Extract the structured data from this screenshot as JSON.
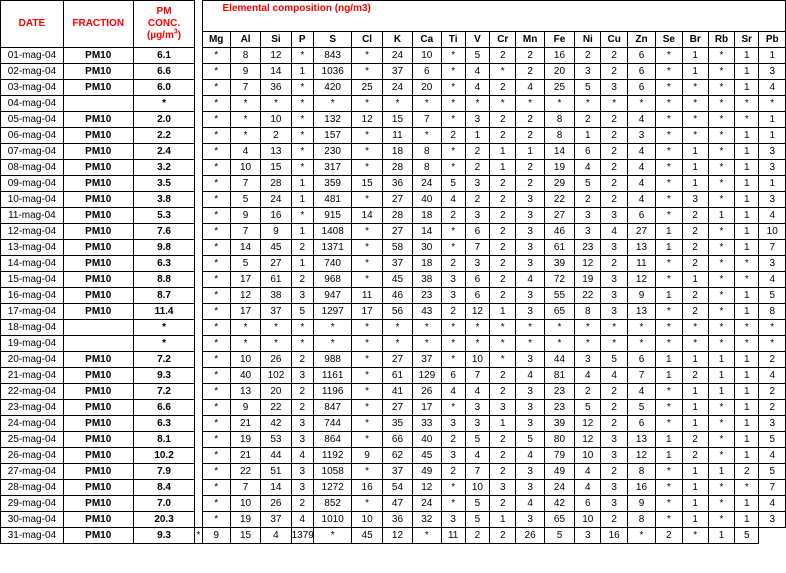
{
  "header": {
    "date_label": "DATE",
    "fraction_label": "FRACTION",
    "pm_label_1": "PM",
    "pm_label_2": "CONC.",
    "pm_unit": "(µg/m",
    "pm_unit_sup": "3",
    "pm_unit_close": ")",
    "elemental_title": "Elemental composition (ng/m3)"
  },
  "elements": [
    "Mg",
    "Al",
    "Si",
    "P",
    "S",
    "Cl",
    "K",
    "Ca",
    "Ti",
    "V",
    "Cr",
    "Mn",
    "Fe",
    "Ni",
    "Cu",
    "Zn",
    "Se",
    "Br",
    "Rb",
    "Sr",
    "Pb"
  ],
  "rows": [
    {
      "date": "01-mag-04",
      "fraction": "PM10",
      "pm": "6.1",
      "values": [
        "*",
        "8",
        "12",
        "*",
        "843",
        "*",
        "24",
        "10",
        "*",
        "5",
        "2",
        "2",
        "16",
        "2",
        "2",
        "6",
        "*",
        "1",
        "*",
        "1",
        "1"
      ]
    },
    {
      "date": "02-mag-04",
      "fraction": "PM10",
      "pm": "6.6",
      "values": [
        "*",
        "9",
        "14",
        "1",
        "1036",
        "*",
        "37",
        "6",
        "*",
        "4",
        "*",
        "2",
        "20",
        "3",
        "2",
        "6",
        "*",
        "1",
        "*",
        "1",
        "3"
      ]
    },
    {
      "date": "03-mag-04",
      "fraction": "PM10",
      "pm": "6.0",
      "values": [
        "*",
        "7",
        "36",
        "*",
        "420",
        "25",
        "24",
        "20",
        "*",
        "4",
        "2",
        "4",
        "25",
        "5",
        "3",
        "6",
        "*",
        "*",
        "*",
        "1",
        "4"
      ]
    },
    {
      "date": "04-mag-04",
      "fraction": "",
      "pm": "*",
      "values": [
        "*",
        "*",
        "*",
        "*",
        "*",
        "*",
        "*",
        "*",
        "*",
        "*",
        "*",
        "*",
        "*",
        "*",
        "*",
        "*",
        "*",
        "*",
        "*",
        "*",
        "*"
      ]
    },
    {
      "date": "05-mag-04",
      "fraction": "PM10",
      "pm": "2.0",
      "values": [
        "*",
        "*",
        "10",
        "*",
        "132",
        "12",
        "15",
        "7",
        "*",
        "3",
        "2",
        "2",
        "8",
        "2",
        "2",
        "4",
        "*",
        "*",
        "*",
        "*",
        "1"
      ]
    },
    {
      "date": "06-mag-04",
      "fraction": "PM10",
      "pm": "2.2",
      "values": [
        "*",
        "*",
        "2",
        "*",
        "157",
        "*",
        "11",
        "*",
        "2",
        "1",
        "2",
        "2",
        "8",
        "1",
        "2",
        "3",
        "*",
        "*",
        "*",
        "1",
        "1"
      ]
    },
    {
      "date": "07-mag-04",
      "fraction": "PM10",
      "pm": "2.4",
      "values": [
        "*",
        "4",
        "13",
        "*",
        "230",
        "*",
        "18",
        "8",
        "*",
        "2",
        "1",
        "1",
        "14",
        "6",
        "2",
        "4",
        "*",
        "1",
        "*",
        "1",
        "3"
      ]
    },
    {
      "date": "08-mag-04",
      "fraction": "PM10",
      "pm": "3.2",
      "values": [
        "*",
        "10",
        "15",
        "*",
        "317",
        "*",
        "28",
        "8",
        "*",
        "2",
        "1",
        "2",
        "19",
        "4",
        "2",
        "4",
        "*",
        "1",
        "*",
        "1",
        "3"
      ]
    },
    {
      "date": "09-mag-04",
      "fraction": "PM10",
      "pm": "3.5",
      "values": [
        "*",
        "7",
        "28",
        "1",
        "359",
        "15",
        "36",
        "24",
        "5",
        "3",
        "2",
        "2",
        "29",
        "5",
        "2",
        "4",
        "*",
        "1",
        "*",
        "1",
        "1"
      ]
    },
    {
      "date": "10-mag-04",
      "fraction": "PM10",
      "pm": "3.8",
      "values": [
        "*",
        "5",
        "24",
        "1",
        "481",
        "*",
        "27",
        "40",
        "4",
        "2",
        "2",
        "3",
        "22",
        "2",
        "2",
        "4",
        "*",
        "3",
        "*",
        "1",
        "3"
      ]
    },
    {
      "date": "11-mag-04",
      "fraction": "PM10",
      "pm": "5.3",
      "values": [
        "*",
        "9",
        "16",
        "*",
        "915",
        "14",
        "28",
        "18",
        "2",
        "3",
        "2",
        "3",
        "27",
        "3",
        "3",
        "6",
        "*",
        "2",
        "1",
        "1",
        "4"
      ]
    },
    {
      "date": "12-mag-04",
      "fraction": "PM10",
      "pm": "7.6",
      "values": [
        "*",
        "7",
        "9",
        "1",
        "1408",
        "*",
        "27",
        "14",
        "*",
        "6",
        "2",
        "3",
        "46",
        "3",
        "4",
        "27",
        "1",
        "2",
        "*",
        "1",
        "10"
      ]
    },
    {
      "date": "13-mag-04",
      "fraction": "PM10",
      "pm": "9.8",
      "values": [
        "*",
        "14",
        "45",
        "2",
        "1371",
        "*",
        "58",
        "30",
        "*",
        "7",
        "2",
        "3",
        "61",
        "23",
        "3",
        "13",
        "1",
        "2",
        "*",
        "1",
        "7"
      ]
    },
    {
      "date": "14-mag-04",
      "fraction": "PM10",
      "pm": "6.3",
      "values": [
        "*",
        "5",
        "27",
        "1",
        "740",
        "*",
        "37",
        "18",
        "2",
        "3",
        "2",
        "3",
        "39",
        "12",
        "2",
        "11",
        "*",
        "2",
        "*",
        "*",
        "3"
      ]
    },
    {
      "date": "15-mag-04",
      "fraction": "PM10",
      "pm": "8.8",
      "values": [
        "*",
        "17",
        "61",
        "2",
        "968",
        "*",
        "45",
        "38",
        "3",
        "6",
        "2",
        "4",
        "72",
        "19",
        "3",
        "12",
        "*",
        "1",
        "*",
        "*",
        "4"
      ]
    },
    {
      "date": "16-mag-04",
      "fraction": "PM10",
      "pm": "8.7",
      "values": [
        "*",
        "12",
        "38",
        "3",
        "947",
        "11",
        "46",
        "23",
        "3",
        "6",
        "2",
        "3",
        "55",
        "22",
        "3",
        "9",
        "1",
        "2",
        "*",
        "1",
        "5"
      ]
    },
    {
      "date": "17-mag-04",
      "fraction": "PM10",
      "pm": "11.4",
      "values": [
        "*",
        "17",
        "37",
        "5",
        "1297",
        "17",
        "56",
        "43",
        "2",
        "12",
        "1",
        "3",
        "65",
        "8",
        "3",
        "13",
        "*",
        "2",
        "*",
        "1",
        "8"
      ]
    },
    {
      "date": "18-mag-04",
      "fraction": "",
      "pm": "*",
      "values": [
        "*",
        "*",
        "*",
        "*",
        "*",
        "*",
        "*",
        "*",
        "*",
        "*",
        "*",
        "*",
        "*",
        "*",
        "*",
        "*",
        "*",
        "*",
        "*",
        "*",
        "*"
      ]
    },
    {
      "date": "19-mag-04",
      "fraction": "",
      "pm": "*",
      "values": [
        "*",
        "*",
        "*",
        "*",
        "*",
        "*",
        "*",
        "*",
        "*",
        "*",
        "*",
        "*",
        "*",
        "*",
        "*",
        "*",
        "*",
        "*",
        "*",
        "*",
        "*"
      ]
    },
    {
      "date": "20-mag-04",
      "fraction": "PM10",
      "pm": "7.2",
      "values": [
        "*",
        "10",
        "26",
        "2",
        "988",
        "*",
        "27",
        "37",
        "*",
        "10",
        "*",
        "3",
        "44",
        "3",
        "5",
        "6",
        "1",
        "1",
        "1",
        "1",
        "2"
      ]
    },
    {
      "date": "21-mag-04",
      "fraction": "PM10",
      "pm": "9.3",
      "values": [
        "*",
        "40",
        "102",
        "3",
        "1161",
        "*",
        "61",
        "129",
        "6",
        "7",
        "2",
        "4",
        "81",
        "4",
        "4",
        "7",
        "1",
        "2",
        "1",
        "1",
        "4"
      ]
    },
    {
      "date": "22-mag-04",
      "fraction": "PM10",
      "pm": "7.2",
      "values": [
        "*",
        "13",
        "20",
        "2",
        "1196",
        "*",
        "41",
        "26",
        "4",
        "4",
        "2",
        "3",
        "23",
        "2",
        "2",
        "4",
        "*",
        "1",
        "1",
        "1",
        "2"
      ]
    },
    {
      "date": "23-mag-04",
      "fraction": "PM10",
      "pm": "6.6",
      "values": [
        "*",
        "9",
        "22",
        "2",
        "847",
        "*",
        "27",
        "17",
        "*",
        "3",
        "3",
        "3",
        "23",
        "5",
        "2",
        "5",
        "*",
        "1",
        "*",
        "1",
        "2"
      ]
    },
    {
      "date": "24-mag-04",
      "fraction": "PM10",
      "pm": "6.3",
      "values": [
        "*",
        "21",
        "42",
        "3",
        "744",
        "*",
        "35",
        "33",
        "3",
        "3",
        "1",
        "3",
        "39",
        "12",
        "2",
        "6",
        "*",
        "1",
        "*",
        "1",
        "3"
      ]
    },
    {
      "date": "25-mag-04",
      "fraction": "PM10",
      "pm": "8.1",
      "values": [
        "*",
        "19",
        "53",
        "3",
        "864",
        "*",
        "66",
        "40",
        "2",
        "5",
        "2",
        "5",
        "80",
        "12",
        "3",
        "13",
        "1",
        "2",
        "*",
        "1",
        "5"
      ]
    },
    {
      "date": "26-mag-04",
      "fraction": "PM10",
      "pm": "10.2",
      "values": [
        "*",
        "21",
        "44",
        "4",
        "1192",
        "9",
        "62",
        "45",
        "3",
        "4",
        "2",
        "4",
        "79",
        "10",
        "3",
        "12",
        "1",
        "2",
        "*",
        "1",
        "4"
      ]
    },
    {
      "date": "27-mag-04",
      "fraction": "PM10",
      "pm": "7.9",
      "values": [
        "*",
        "22",
        "51",
        "3",
        "1058",
        "*",
        "37",
        "49",
        "2",
        "7",
        "2",
        "3",
        "49",
        "4",
        "2",
        "8",
        "*",
        "1",
        "1",
        "2",
        "5"
      ]
    },
    {
      "date": "28-mag-04",
      "fraction": "PM10",
      "pm": "8.4",
      "values": [
        "*",
        "7",
        "14",
        "3",
        "1272",
        "16",
        "54",
        "12",
        "*",
        "10",
        "3",
        "3",
        "24",
        "4",
        "3",
        "16",
        "*",
        "1",
        "*",
        "*",
        "7"
      ]
    },
    {
      "date": "29-mag-04",
      "fraction": "PM10",
      "pm": "7.0",
      "values": [
        "*",
        "10",
        "26",
        "2",
        "852",
        "*",
        "47",
        "24",
        "*",
        "5",
        "2",
        "4",
        "42",
        "6",
        "3",
        "9",
        "*",
        "1",
        "*",
        "1",
        "4"
      ]
    },
    {
      "date": "30-mag-04",
      "fraction": "PM10",
      "pm": "20.3",
      "values": [
        "*",
        "19",
        "37",
        "4",
        "1010",
        "10",
        "36",
        "32",
        "3",
        "5",
        "1",
        "3",
        "65",
        "10",
        "2",
        "8",
        "*",
        "1",
        "*",
        "1",
        "3"
      ]
    },
    {
      "date": "31-mag-04",
      "fraction": "PM10",
      "pm": "9.3",
      "values": [
        "*",
        "9",
        "15",
        "4",
        "1379",
        "*",
        "45",
        "12",
        "*",
        "11",
        "2",
        "2",
        "26",
        "5",
        "3",
        "16",
        "*",
        "2",
        "*",
        "1",
        "5"
      ]
    }
  ]
}
